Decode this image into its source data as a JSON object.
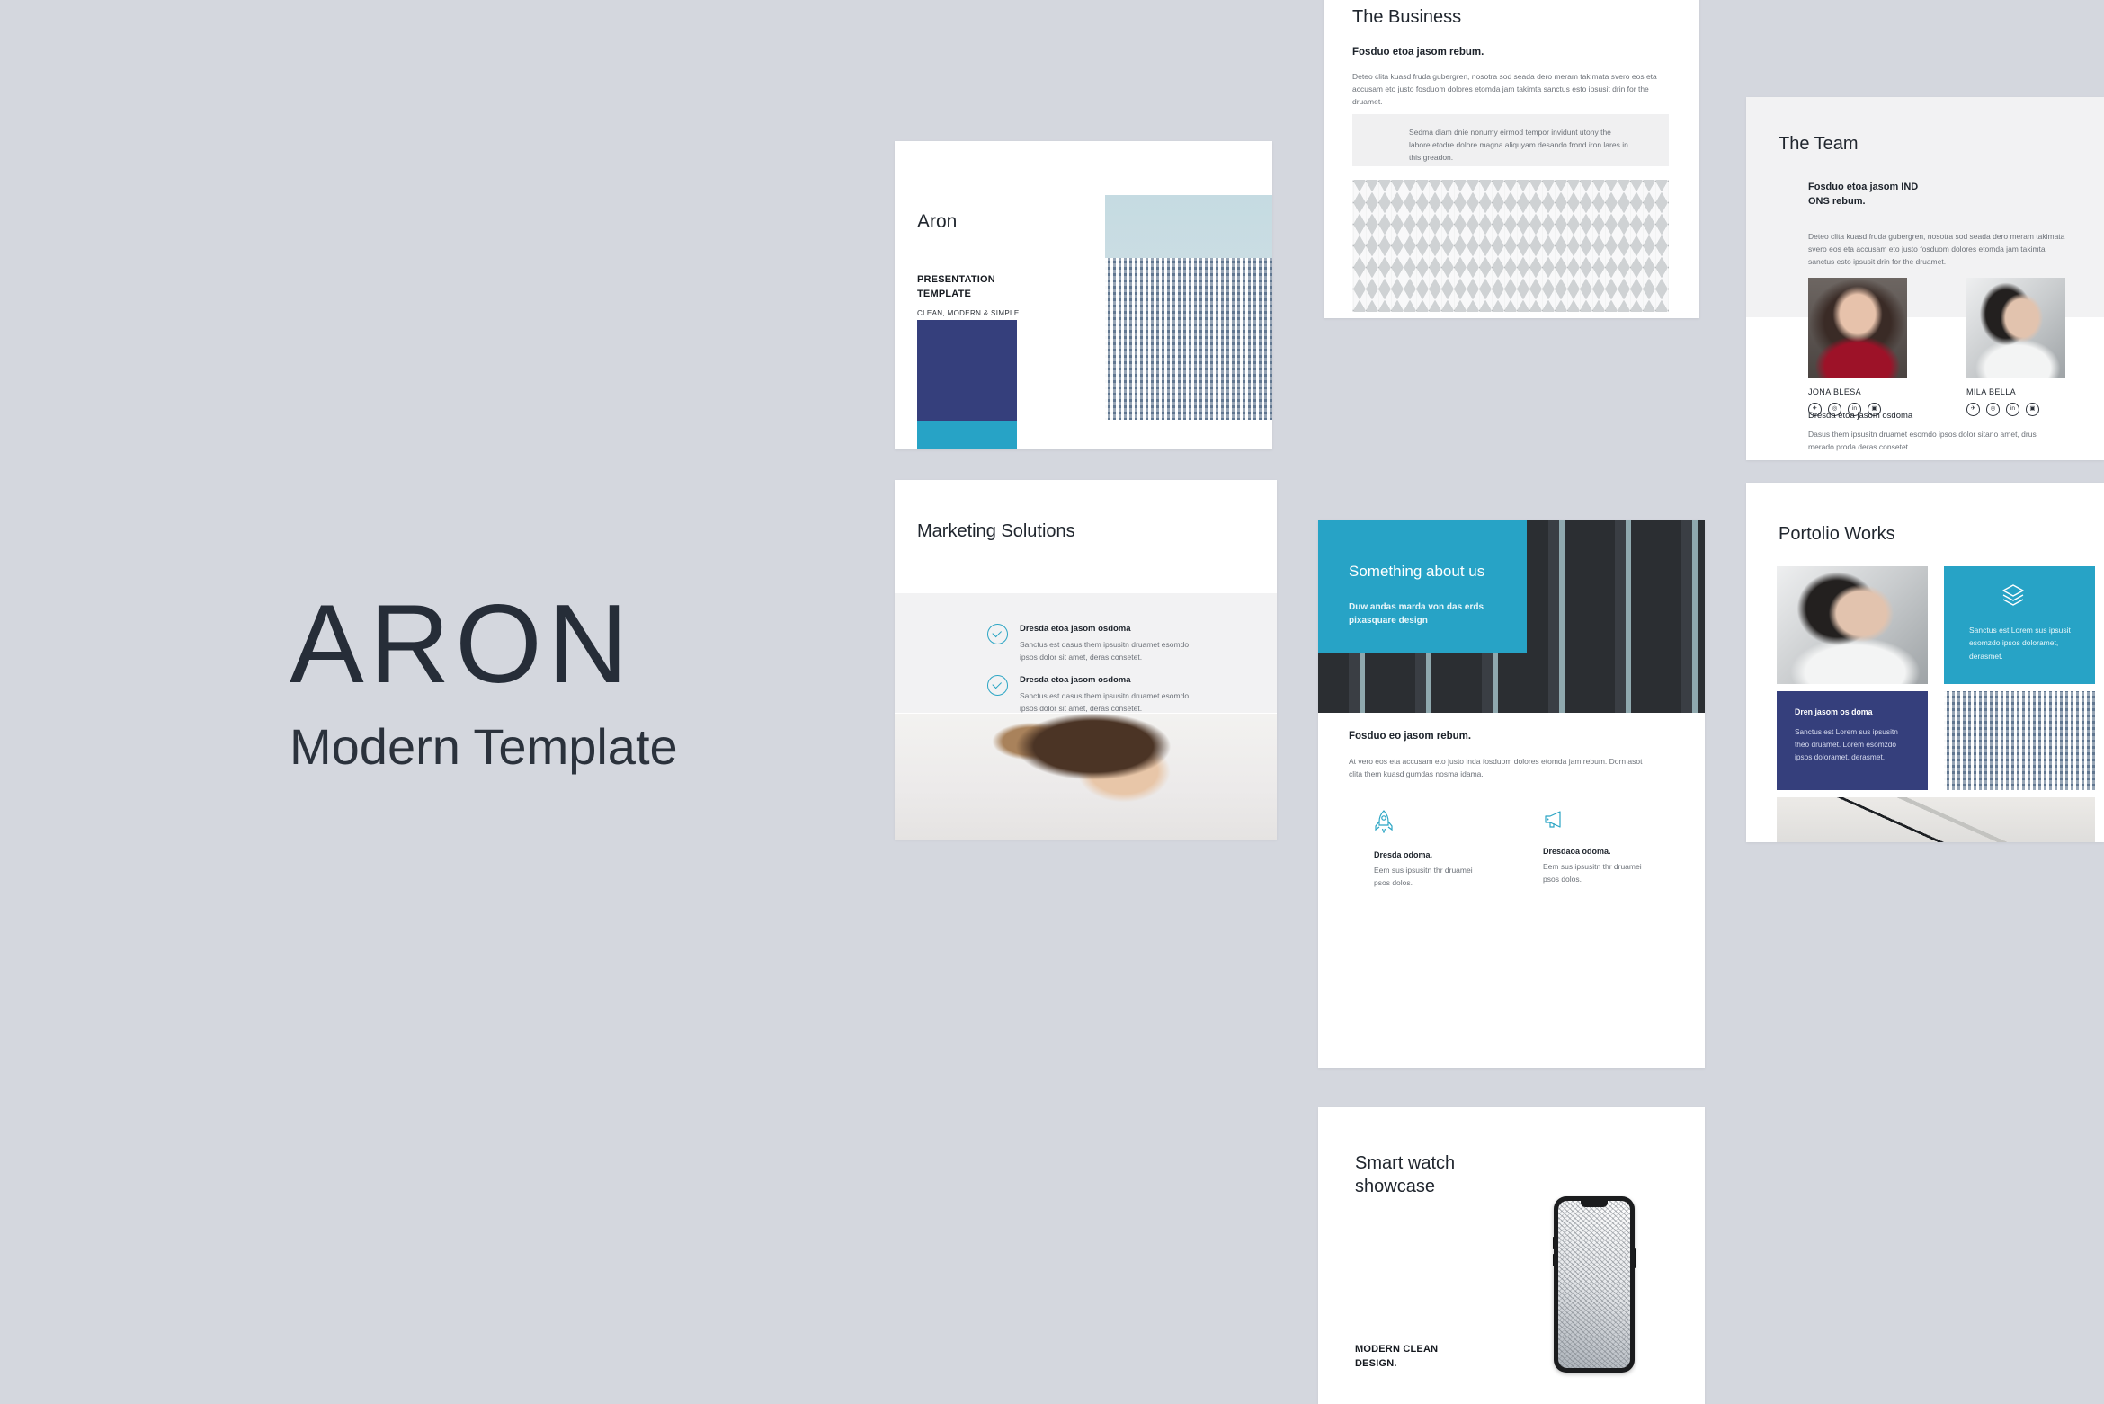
{
  "brand": {
    "name": "ARON",
    "tagline": "Modern Template"
  },
  "colors": {
    "canvas": "#d4d7de",
    "navy": "#353f7c",
    "cyan": "#27a3c6",
    "accent_teal": "#2ba5c4",
    "ink": "#20262e",
    "body_text": "#6d7279",
    "panel_grey": "#f2f2f3"
  },
  "slides": {
    "cover": {
      "title": "Aron",
      "kicker": "PRESENTATION\nTEMPLATE",
      "kicker_line1": "PRESENTATION",
      "kicker_line2": "TEMPLATE",
      "footer": "CLEAN, MODERN & SIMPLE",
      "image_alt": "twin-towers-building-photo"
    },
    "marketing": {
      "title": "Marketing Solutions",
      "items": [
        {
          "heading": "Dresda etoa jasom osdoma",
          "body": "Sanctus est dasus them ipsusitn druamet esomdo ipsos dolor sit amet, deras consetet."
        },
        {
          "heading": "Dresda etoa jasom osdoma",
          "body": "Sanctus est dasus them ipsusitn druamet esomdo ipsos dolor sit amet, deras consetet."
        }
      ],
      "image_alt": "woman-profile-hair-bun-photo"
    },
    "business": {
      "title": "The Business",
      "subtitle": "Fosduo etoa jasom rebum.",
      "body": "Deteo clita kuasd fruda gubergren, nosotra sod seada dero meram takimata svero eos eta accusam eto justo fosduom dolores etomda jam takimta sanctus esto ipsusit drin for the druamet.",
      "callout": "Sedma diam dnie nonumy eirmod tempor invidunt utony the labore etodre dolore magna aliquyam desando frond iron lares in this greadon.",
      "image_alt": "hexagon-facade-architecture-photo"
    },
    "about": {
      "title": "Something about us",
      "subtitle": "Duw andas marda von das erds pixasquare design",
      "section_heading": "Fosduo eo jasom rebum.",
      "section_body": "At vero eos eta accusam eto justo inda fosduom dolores etomda jam rebum. Dorn asot clita them kuasd gumdas nosma idama.",
      "features": [
        {
          "icon": "rocket-icon",
          "heading": "Dresda odoma.",
          "body": "Eem sus  ipsusitn thr druamei psos dolos."
        },
        {
          "icon": "megaphone-icon",
          "heading": "Dresdaoa odoma.",
          "body": "Eem sus  ipsusitn thr druamei psos dolos."
        }
      ],
      "image_alt": "dark-apartment-facade-photo"
    },
    "smartwatch": {
      "title_line1": "Smart watch",
      "title_line2": "showcase",
      "footer_line1": "MODERN CLEAN",
      "footer_line2": "DESIGN.",
      "image_alt": "smartphone-mockup-mesh-wallpaper"
    },
    "team": {
      "title": "The Team",
      "subtitle_line1": "Fosduo etoa jasom IND",
      "subtitle_line2": "ONS rebum.",
      "body": "Deteo clita kuasd fruda gubergren, nosotra sod seada dero meram takimata svero eos eta accusam eto justo fosduom dolores etomda jam takimta sanctus esto ipsusit drin for the druamet.",
      "members": [
        {
          "name": "JONA BLESA",
          "photo_alt": "smiling-woman-red-top-portrait"
        },
        {
          "name": "MILA BELLA",
          "photo_alt": "woman-white-shirt-shadow-portrait"
        }
      ],
      "social_icons": [
        "twitter-icon",
        "instagram-icon",
        "linkedin-icon",
        "behance-icon"
      ],
      "social_glyphs": [
        "✈",
        "◎",
        "in",
        "▣"
      ],
      "footer_heading": "Dresda etoa jasom osdoma",
      "footer_body": "Dasus them ipsusitn druamet esomdo ipsos dolor sitano amet, drus merado proda deras consetet."
    },
    "portfolio": {
      "title": "Portolio Works",
      "cells": [
        {
          "type": "photo",
          "photo_alt": "woman-hand-on-face-sunlight-photo"
        },
        {
          "type": "cyan-card",
          "icon": "layers-icon",
          "body": "Sanctus est Lorem sus ipsusit esomzdo ipsos doloramet, derasmet."
        },
        {
          "type": "navy-card",
          "heading": "Dren jasom os doma",
          "body": "Sanctus est Lorem sus ipsusitn theo druamet. Lorem esomzdo ipsos doloramet, derasmet."
        },
        {
          "type": "photo",
          "photo_alt": "twin-towers-building-photo"
        },
        {
          "type": "photo-wide",
          "photo_alt": "man-walking-down-staircase-photo"
        }
      ]
    }
  }
}
